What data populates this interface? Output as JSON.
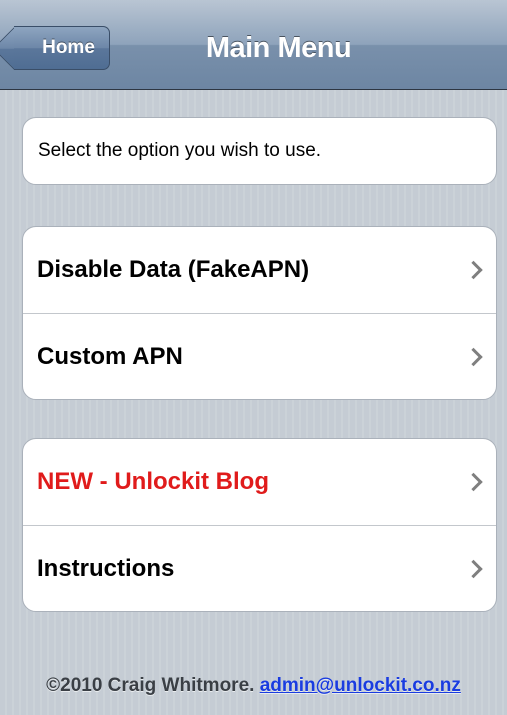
{
  "navbar": {
    "back_label": "Home",
    "title": "Main Menu"
  },
  "intro": {
    "text": "Select the option you wish to use."
  },
  "groups": [
    {
      "items": [
        {
          "label": "Disable Data (FakeAPN)",
          "highlight": false
        },
        {
          "label": "Custom APN",
          "highlight": false
        }
      ]
    },
    {
      "items": [
        {
          "label": "NEW - Unlockit Blog",
          "highlight": true,
          "color": "#e01b1b"
        },
        {
          "label": "Instructions",
          "highlight": false
        }
      ]
    }
  ],
  "footer": {
    "copyright": "©2010 Craig Whitmore.",
    "email": "admin@unlockit.co.nz"
  },
  "colors": {
    "navbar": "#7990ab",
    "background": "#c5ccd4",
    "highlight_text": "#e01b1b",
    "link": "#1a3ce0"
  },
  "icons": {
    "row_chevron": "chevron-right-icon"
  }
}
